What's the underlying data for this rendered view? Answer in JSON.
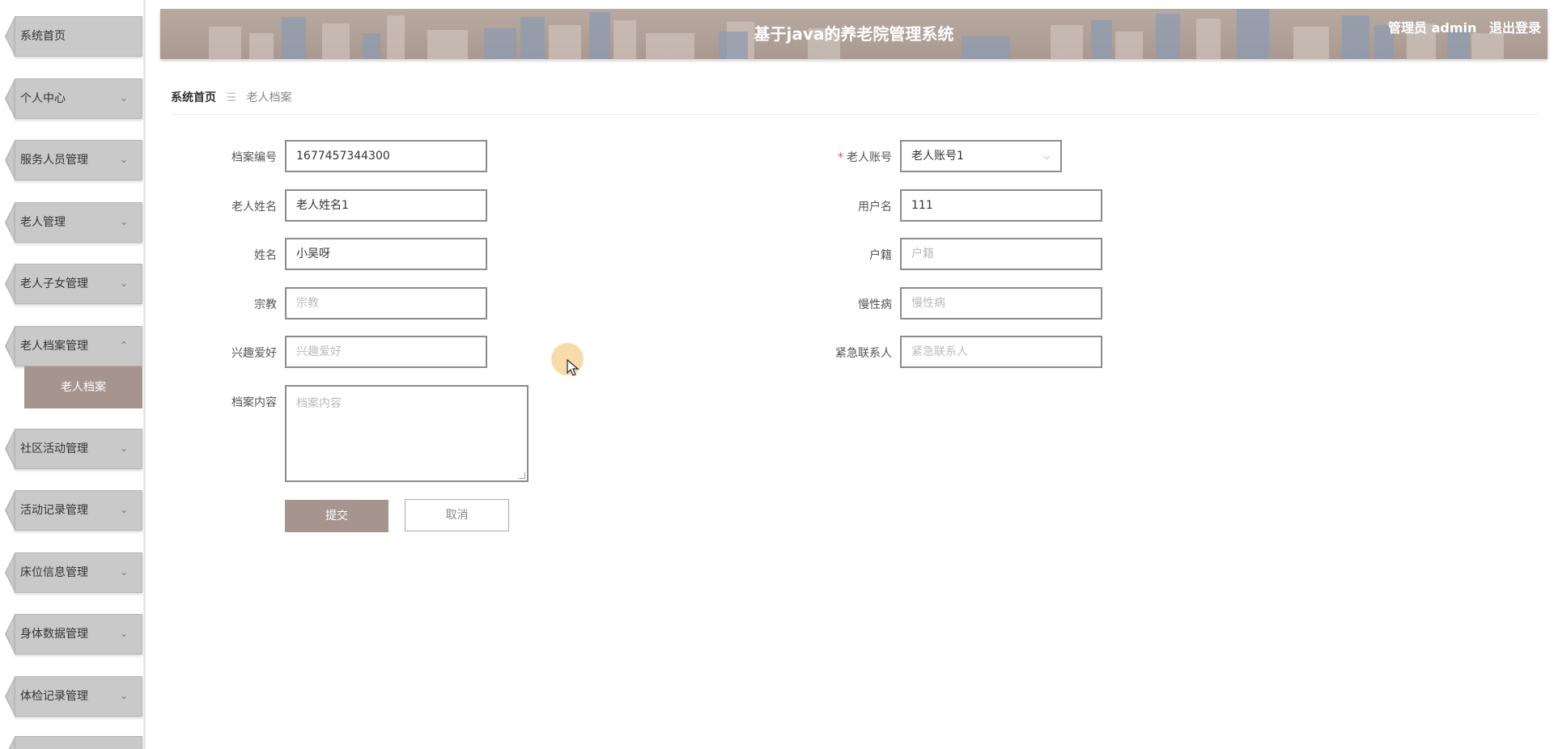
{
  "app": {
    "title": "基于java的养老院管理系统",
    "user_role": "管理员 admin",
    "logout": "退出登录"
  },
  "sidebar": {
    "items": [
      {
        "label": "系统首页",
        "has_chevron": false
      },
      {
        "label": "个人中心",
        "chevron": "⌄"
      },
      {
        "label": "服务人员管理",
        "chevron": "⌄"
      },
      {
        "label": "老人管理",
        "chevron": "⌄"
      },
      {
        "label": "老人子女管理",
        "chevron": "⌄"
      },
      {
        "label": "老人档案管理",
        "chevron": "⌃"
      },
      {
        "label": "社区活动管理",
        "chevron": "⌄"
      },
      {
        "label": "活动记录管理",
        "chevron": "⌄"
      },
      {
        "label": "床位信息管理",
        "chevron": "⌄"
      },
      {
        "label": "身体数据管理",
        "chevron": "⌄"
      },
      {
        "label": "体检记录管理",
        "chevron": "⌄"
      }
    ],
    "active_sub": "老人档案"
  },
  "breadcrumb": {
    "home": "系统首页",
    "sep": "☰",
    "current": "老人档案"
  },
  "form": {
    "archive_no": {
      "label": "档案编号",
      "value": "1677457344300"
    },
    "elder_account": {
      "label": "老人账号",
      "required_mark": "*",
      "value": "老人账号1"
    },
    "elder_name": {
      "label": "老人姓名",
      "value": "老人姓名1"
    },
    "username": {
      "label": "用户名",
      "value": "111"
    },
    "name": {
      "label": "姓名",
      "value": "小吴呀"
    },
    "household": {
      "label": "户籍",
      "placeholder": "户籍"
    },
    "religion": {
      "label": "宗教",
      "placeholder": "宗教"
    },
    "chronic": {
      "label": "慢性病",
      "placeholder": "慢性病"
    },
    "hobby": {
      "label": "兴趣爱好",
      "placeholder": "兴趣爱好"
    },
    "emergency": {
      "label": "紧急联系人",
      "placeholder": "紧急联系人"
    },
    "content": {
      "label": "档案内容",
      "placeholder": "档案内容"
    },
    "submit": "提交",
    "cancel": "取消"
  },
  "colors": {
    "accent": "#a5958e",
    "sidebar_tab": "#c9c9c9",
    "required": "#e04a4a"
  }
}
